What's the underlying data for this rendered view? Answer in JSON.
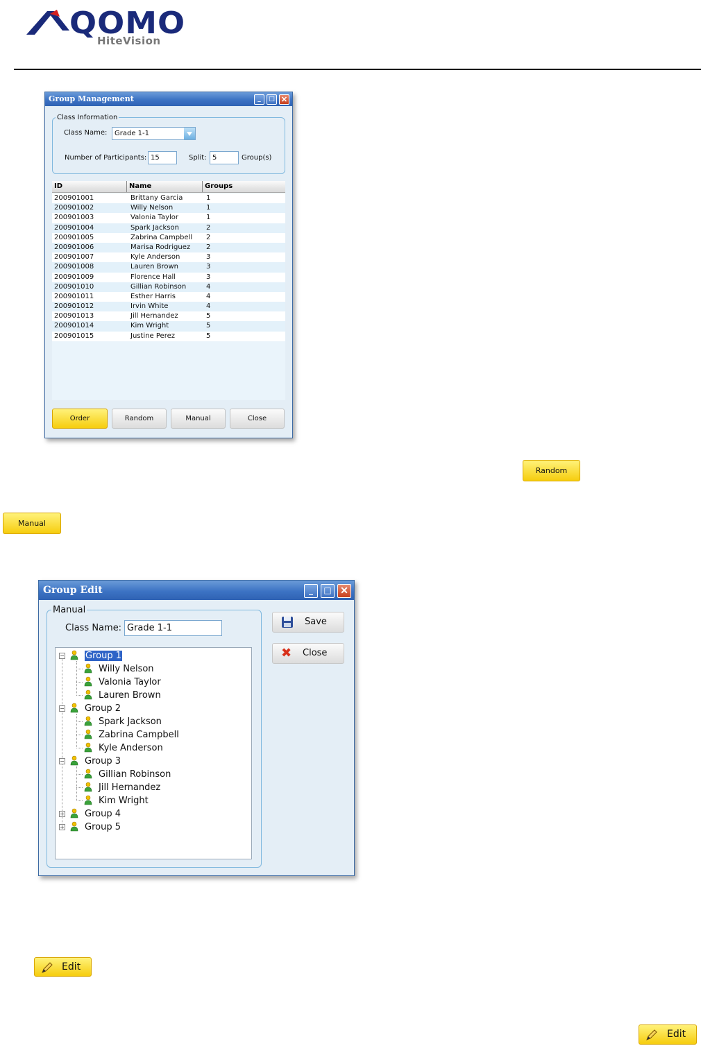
{
  "logo": {
    "brand": "QOMO",
    "sub": "HiteVision"
  },
  "group_management": {
    "title": "Group Management",
    "class_info_legend": "Class Information",
    "class_name_label": "Class Name:",
    "class_name_value": "Grade 1-1",
    "participants_label": "Number of Participants:",
    "participants_value": "15",
    "split_label": "Split:",
    "split_value": "5",
    "groups_suffix": "Group(s)",
    "columns": [
      "ID",
      "Name",
      "Groups"
    ],
    "rows": [
      {
        "id": "200901001",
        "name": "Brittany Garcia",
        "group": "1"
      },
      {
        "id": "200901002",
        "name": "Willy Nelson",
        "group": "1"
      },
      {
        "id": "200901003",
        "name": "Valonia Taylor",
        "group": "1"
      },
      {
        "id": "200901004",
        "name": "Spark Jackson",
        "group": "2"
      },
      {
        "id": "200901005",
        "name": "Zabrina Campbell",
        "group": "2"
      },
      {
        "id": "200901006",
        "name": "Marisa Rodriguez",
        "group": "2"
      },
      {
        "id": "200901007",
        "name": "Kyle Anderson",
        "group": "3"
      },
      {
        "id": "200901008",
        "name": "Lauren Brown",
        "group": "3"
      },
      {
        "id": "200901009",
        "name": "Florence Hall",
        "group": "3"
      },
      {
        "id": "200901010",
        "name": "Gillian Robinson",
        "group": "4"
      },
      {
        "id": "200901011",
        "name": "Esther Harris",
        "group": "4"
      },
      {
        "id": "200901012",
        "name": "Irvin White",
        "group": "4"
      },
      {
        "id": "200901013",
        "name": "Jill Hernandez",
        "group": "5"
      },
      {
        "id": "200901014",
        "name": "Kim Wright",
        "group": "5"
      },
      {
        "id": "200901015",
        "name": "Justine Perez",
        "group": "5"
      }
    ],
    "buttons": {
      "order": "Order",
      "random": "Random",
      "manual": "Manual",
      "close": "Close"
    }
  },
  "standalone": {
    "random": "Random",
    "manual": "Manual",
    "edit1": "Edit",
    "edit2": "Edit"
  },
  "group_edit": {
    "title": "Group Edit",
    "legend": "Manual",
    "class_name_label": "Class Name:",
    "class_name_value": "Grade 1-1",
    "save": "Save",
    "close": "Close",
    "tree": [
      {
        "label": "Group 1",
        "expanded": true,
        "selected": true,
        "members": [
          "Willy Nelson",
          "Valonia Taylor",
          "Lauren Brown"
        ]
      },
      {
        "label": "Group 2",
        "expanded": true,
        "selected": false,
        "members": [
          "Spark Jackson",
          "Zabrina Campbell",
          "Kyle Anderson"
        ]
      },
      {
        "label": "Group 3",
        "expanded": true,
        "selected": false,
        "members": [
          "Gillian Robinson",
          "Jill Hernandez",
          "Kim Wright"
        ]
      },
      {
        "label": "Group 4",
        "expanded": false,
        "selected": false,
        "members": []
      },
      {
        "label": "Group 5",
        "expanded": false,
        "selected": false,
        "members": []
      }
    ]
  },
  "colors": {
    "title_blue": "#3c73c4",
    "window_bg": "#e4eef6",
    "yellow_button": "#f6cd0e",
    "selection": "#2e63c7"
  }
}
